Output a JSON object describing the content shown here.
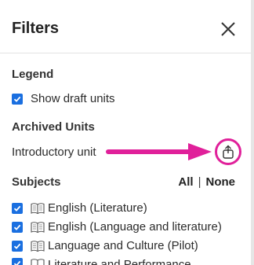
{
  "header": {
    "title": "Filters"
  },
  "legend": {
    "section_title": "Legend",
    "show_draft_label": "Show draft units",
    "show_draft_checked": true
  },
  "archived": {
    "section_title": "Archived Units",
    "unit_label": "Introductory unit"
  },
  "subjects": {
    "section_title": "Subjects",
    "all_label": "All",
    "separator": "|",
    "none_label": "None",
    "items": [
      {
        "label": "English (Literature)",
        "checked": true
      },
      {
        "label": "English (Language and literature)",
        "checked": true
      },
      {
        "label": "Language and Culture (Pilot)",
        "checked": true
      },
      {
        "label": "Literature and Performance",
        "checked": true
      }
    ]
  },
  "colors": {
    "accent": "#1a6fe0",
    "annotation": "#e0209a"
  },
  "icons": {
    "close": "close-icon",
    "checkbox": "check-icon",
    "subject": "book-icon",
    "unarchive": "unarchive-icon"
  }
}
